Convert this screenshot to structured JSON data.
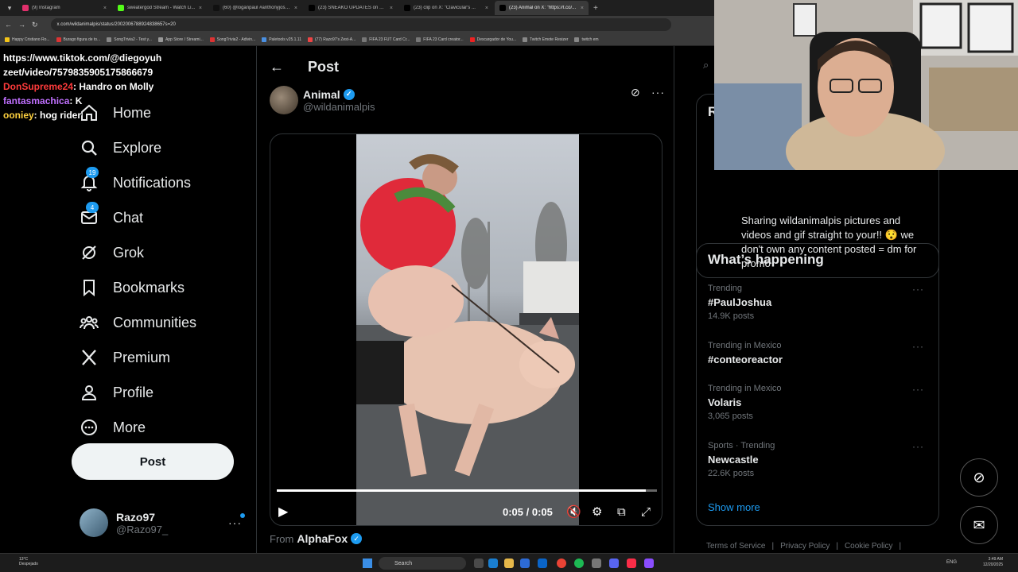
{
  "browser": {
    "tabs": [
      {
        "label": "(9) Instagram",
        "color": "#e1306c"
      },
      {
        "label": "sweatergod Stream - Watch Li...",
        "color": "#53fc18"
      },
      {
        "label": "(60) @loganpaul #anthonyjosh...",
        "color": "#111111"
      },
      {
        "label": "(23) SNEAKO UPDATES on X: \"...",
        "color": "#000000"
      },
      {
        "label": "(23) clip on X: \"Clavicular's ...",
        "color": "#000000"
      },
      {
        "label": "(23) Animal on X: \"https://t.co/...",
        "color": "#000000"
      }
    ],
    "url": "x.com/wildanimalpis/status/2002006788924838657s=20",
    "bookmarks": [
      "Happy Cristiano Ro...",
      "Burago figura de to...",
      "SongTrivia2 - Test y...",
      "App Store / Streami...",
      "SongTrivia2 - Adivin...",
      "Paletools v25.1.11",
      "(77) Razo97's Zest-A...",
      "FIFA 23 FUT Card Cr...",
      "FIFA 23 Card creator...",
      "Descargador de You...",
      "Twitch Emote Resizer",
      "twitch em"
    ]
  },
  "chat_overlay": {
    "link_line1": "https://www.tiktok.com/@diegoyuh",
    "link_line2": "zeet/video/7579835905175866679",
    "messages": [
      {
        "user": "DonSupreme24",
        "text": ": Handro on Molly",
        "color": "#ff3b3b"
      },
      {
        "user": "fantasmachica",
        "text": ": K",
        "color": "#c070ff"
      },
      {
        "user": "ooniey",
        "text": ": hog rider",
        "color": "#ffd23f"
      }
    ]
  },
  "nav": {
    "items": [
      {
        "label": "Home",
        "icon": "home-icon"
      },
      {
        "label": "Explore",
        "icon": "search-icon"
      },
      {
        "label": "Notifications",
        "icon": "bell-icon",
        "badge": "19"
      },
      {
        "label": "Chat",
        "icon": "mail-icon",
        "badge": "4"
      },
      {
        "label": "Grok",
        "icon": "grok-icon"
      },
      {
        "label": "Bookmarks",
        "icon": "bookmark-icon"
      },
      {
        "label": "Communities",
        "icon": "communities-icon"
      },
      {
        "label": "Premium",
        "icon": "x-logo-icon"
      },
      {
        "label": "Profile",
        "icon": "person-icon"
      },
      {
        "label": "More",
        "icon": "more-circle-icon"
      }
    ],
    "post_button": "Post",
    "account": {
      "name": "Razo97",
      "handle": "@Razo97_"
    }
  },
  "post": {
    "header_title": "Post",
    "author_name": "Animal",
    "author_handle": "@wildanimalpis",
    "video": {
      "time": "0:05 / 0:05",
      "progress": 0.97
    },
    "from_label": "From",
    "from_name": "AlphaFox"
  },
  "right": {
    "profile_initial": "R",
    "bio": "Sharing wildanimalpis pictures and videos and gif straight to your!! 😯 we don't own any content posted = dm for promo",
    "happening_title": "What’s happening",
    "trends": [
      {
        "context": "Trending",
        "name": "#PaulJoshua",
        "count": "14.9K posts"
      },
      {
        "context": "Trending in Mexico",
        "name": "#conteoreactor",
        "count": ""
      },
      {
        "context": "Trending in Mexico",
        "name": "Volaris",
        "count": "3,065 posts"
      },
      {
        "context": "Sports · Trending",
        "name": "Newcastle",
        "count": "22.6K posts"
      }
    ],
    "show_more": "Show more",
    "footer_links": [
      "Terms of Service",
      "|",
      "Privacy Policy",
      "|",
      "Cookie Policy",
      "|"
    ]
  },
  "taskbar": {
    "weather_temp": "13°C",
    "weather_desc": "Despejado",
    "search": "Search",
    "lang": "ENG",
    "time": "3:49 AM",
    "date": "12/20/2025"
  },
  "colors": {
    "accent": "#1d9bf0",
    "background": "#000000",
    "border": "#2f3336",
    "secondary_text": "#71767b"
  }
}
